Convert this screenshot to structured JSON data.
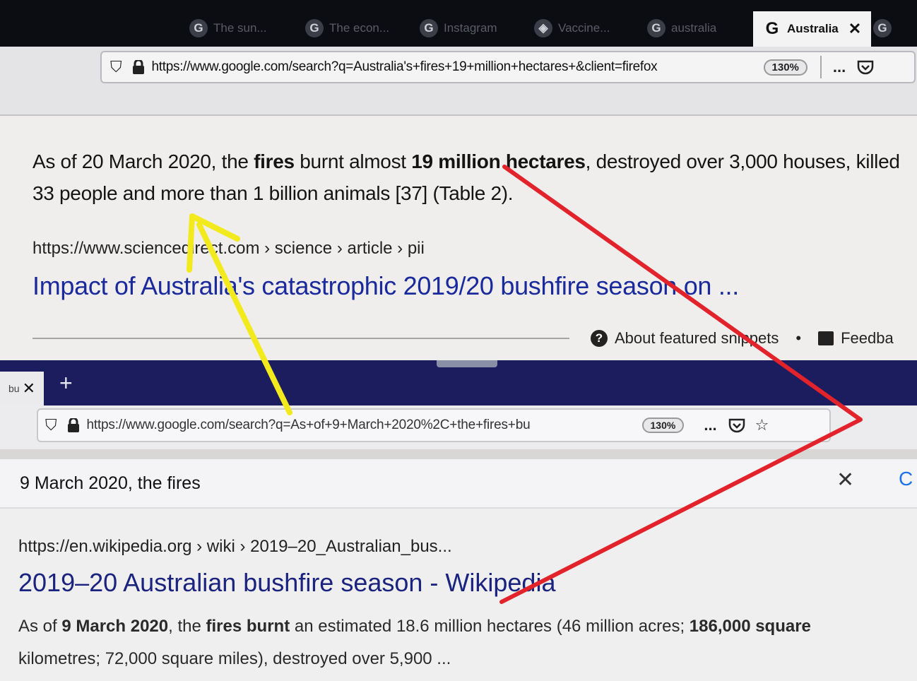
{
  "top_browser": {
    "tabs": [
      {
        "label": "The sun..."
      },
      {
        "label": "The econ..."
      },
      {
        "label": "Instagram"
      },
      {
        "label": "Vaccine..."
      },
      {
        "label": "australia"
      },
      {
        "label": "Australia"
      }
    ],
    "url": "https://www.google.com/search?q=Australia's+fires+19+million+hectares+&client=firefox",
    "zoom": "130%",
    "menu_icon": "...",
    "snippet": {
      "p1": "As of 20 March 2020, the ",
      "b1": "fires",
      "p2": " burnt almost ",
      "b2": "19 million hectares",
      "p3": ", destroyed over 3,000 houses, killed 33 people and more than 1 billion animals [37] (Table 2)."
    },
    "source_breadcrumb": "https://www.sciencedirect.com › science › article › pii",
    "result_title": "Impact of Australia's catastrophic 2019/20 bushfire season on ...",
    "about_featured": "About featured snippets",
    "separator": "•",
    "feedback": "Feedba"
  },
  "bottom_browser": {
    "tab_label": "bu",
    "new_tab": "+",
    "url": "https://www.google.com/search?q=As+of+9+March+2020%2C+the+fires+bu",
    "zoom": "130%",
    "menu_icon": "...",
    "find_text": "9 March 2020, the fires",
    "find_close": "✕",
    "find_c": "C",
    "source_breadcrumb": "https://en.wikipedia.org › wiki › 2019–20_Australian_bus...",
    "result_title": "2019–20 Australian bushfire season - Wikipedia",
    "snippet": {
      "p1": "As of ",
      "b1": "9 March 2020",
      "p2": ", the ",
      "b2": "fires",
      "p3": " ",
      "b3": "burnt",
      "p4": " an estimated 18.6 million hectares (46 million acres; ",
      "b4": "186,000 square",
      "p5": " kilometres; 72,000 square miles), destroyed over 5,900 ..."
    }
  },
  "annotations": {
    "yellow": "#f2ea1c",
    "red": "#e3232b"
  }
}
